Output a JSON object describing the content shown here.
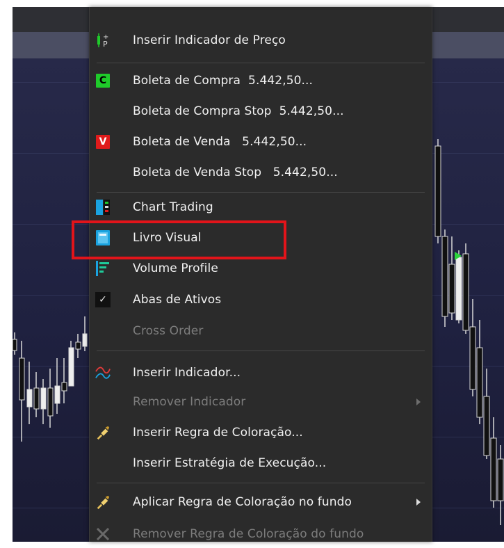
{
  "menu": {
    "items": [
      {
        "label": "Inserir Indicador de Preço",
        "icon": "price-indicator-icon",
        "enabled": true
      },
      {
        "label": "Boleta de Compra  5.442,50...",
        "icon": "buy-order-c-icon",
        "icon_text": "C",
        "enabled": true
      },
      {
        "label": "Boleta de Compra Stop  5.442,50...",
        "enabled": true
      },
      {
        "label": "Boleta de Venda   5.442,50...",
        "icon": "sell-order-v-icon",
        "icon_text": "V",
        "enabled": true
      },
      {
        "label": "Boleta de Venda Stop   5.442,50...",
        "enabled": true
      },
      {
        "label": "Chart Trading",
        "icon": "chart-trading-icon",
        "enabled": true
      },
      {
        "label": "Livro Visual",
        "icon": "visual-book-icon",
        "enabled": true,
        "highlighted": true
      },
      {
        "label": "Volume Profile",
        "icon": "volume-profile-icon",
        "enabled": true
      },
      {
        "label": "Abas de Ativos",
        "icon": "checkmark-icon",
        "checked": true,
        "enabled": true
      },
      {
        "label": "Cross Order",
        "enabled": false
      },
      {
        "label": "Inserir Indicador...",
        "icon": "indicator-lines-icon",
        "enabled": true
      },
      {
        "label": "Remover Indicador",
        "enabled": false,
        "submenu": true
      },
      {
        "label": "Inserir Regra de Coloração...",
        "icon": "paint-brush-icon",
        "enabled": true
      },
      {
        "label": "Inserir Estratégia de Execução...",
        "enabled": true
      },
      {
        "label": "Aplicar Regra de Coloração no fundo",
        "icon": "paint-brush-icon",
        "enabled": true,
        "submenu": true
      },
      {
        "label": "Remover Regra de Coloração do fundo",
        "icon": "remove-x-icon",
        "enabled": false
      }
    ]
  },
  "colors": {
    "menu_bg": "#2b2b2b",
    "highlight_border": "#e2141a",
    "buy_green": "#1fcb2a",
    "sell_red": "#e01b1b",
    "chart_bg": "#20213a"
  }
}
